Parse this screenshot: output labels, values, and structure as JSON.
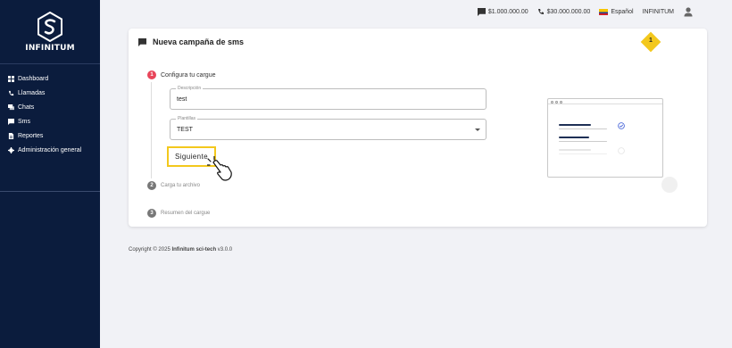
{
  "brand": {
    "name": "INFINITUM"
  },
  "sidebar": {
    "items": [
      {
        "label": "Dashboard",
        "icon": "grid-icon"
      },
      {
        "label": "Llamadas",
        "icon": "phone-icon"
      },
      {
        "label": "Chats",
        "icon": "chats-icon"
      },
      {
        "label": "Sms",
        "icon": "message-icon"
      },
      {
        "label": "Reportes",
        "icon": "report-icon"
      },
      {
        "label": "Administración general",
        "icon": "gear-icon"
      }
    ]
  },
  "topbar": {
    "sms_balance": "$1.000.000.00",
    "call_balance": "$30.000.000.00",
    "language": "Español",
    "username": "INFINITUM"
  },
  "card": {
    "title": "Nueva campaña de sms",
    "badge": "1",
    "steps": [
      {
        "number": "1",
        "label": "Configura tu cargue"
      },
      {
        "number": "2",
        "label": "Carga tu archivo"
      },
      {
        "number": "3",
        "label": "Resumen del cargue"
      }
    ],
    "description_field": {
      "label": "Descripción",
      "value": "test"
    },
    "template_field": {
      "label": "Plantillas",
      "value": "TEST"
    },
    "next_button": "Siguiente"
  },
  "footer": {
    "prefix": "Copyright © 2025 ",
    "company": "Infinitum sci-tech",
    "version": " v3.0.0"
  },
  "colors": {
    "sidebar_bg": "#0b1c3d",
    "accent_yellow": "#f3c81d",
    "step_active": "#e8455a"
  }
}
